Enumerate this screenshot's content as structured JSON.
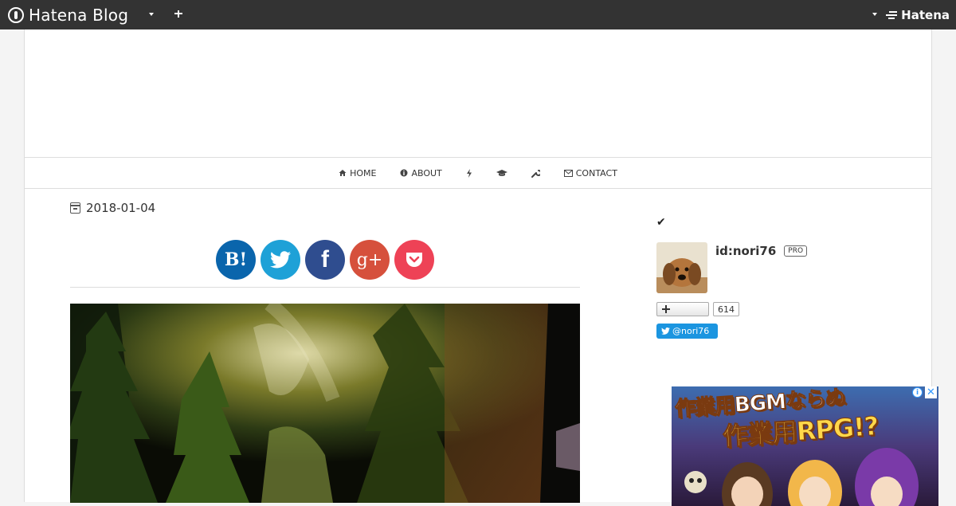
{
  "topbar": {
    "brand": "Hatena Blog",
    "hatena_label": "Hatena"
  },
  "nav": {
    "items": [
      {
        "label": "HOME",
        "icon": "home-icon"
      },
      {
        "label": "ABOUT",
        "icon": "info-icon"
      },
      {
        "label": "",
        "icon": "bolt-icon"
      },
      {
        "label": "",
        "icon": "graduation-cap-icon"
      },
      {
        "label": "",
        "icon": "wrench-icon"
      },
      {
        "label": "CONTACT",
        "icon": "envelope-icon"
      }
    ]
  },
  "article": {
    "date": "2018-01-04",
    "share": [
      {
        "label": "B!",
        "icon": "hatena-bookmark-icon",
        "color": "#0a65ac"
      },
      {
        "label": "",
        "icon": "twitter-icon",
        "color": "#1ea1d7"
      },
      {
        "label": "f",
        "icon": "facebook-icon",
        "color": "#2f4d8f"
      },
      {
        "label": "g+",
        "icon": "google-plus-icon",
        "color": "#d6503c"
      },
      {
        "label": "",
        "icon": "pocket-icon",
        "color": "#ee4256"
      }
    ]
  },
  "sidebar": {
    "profile_id": "id:nori76",
    "pro_badge": "PRO",
    "follower_count": "614",
    "twitter_handle": "@nori76"
  },
  "ad": {
    "line1": "作業用BGMならぬ",
    "line2": "作業用RPG!?",
    "info_label": "i",
    "close_label": "✕"
  }
}
